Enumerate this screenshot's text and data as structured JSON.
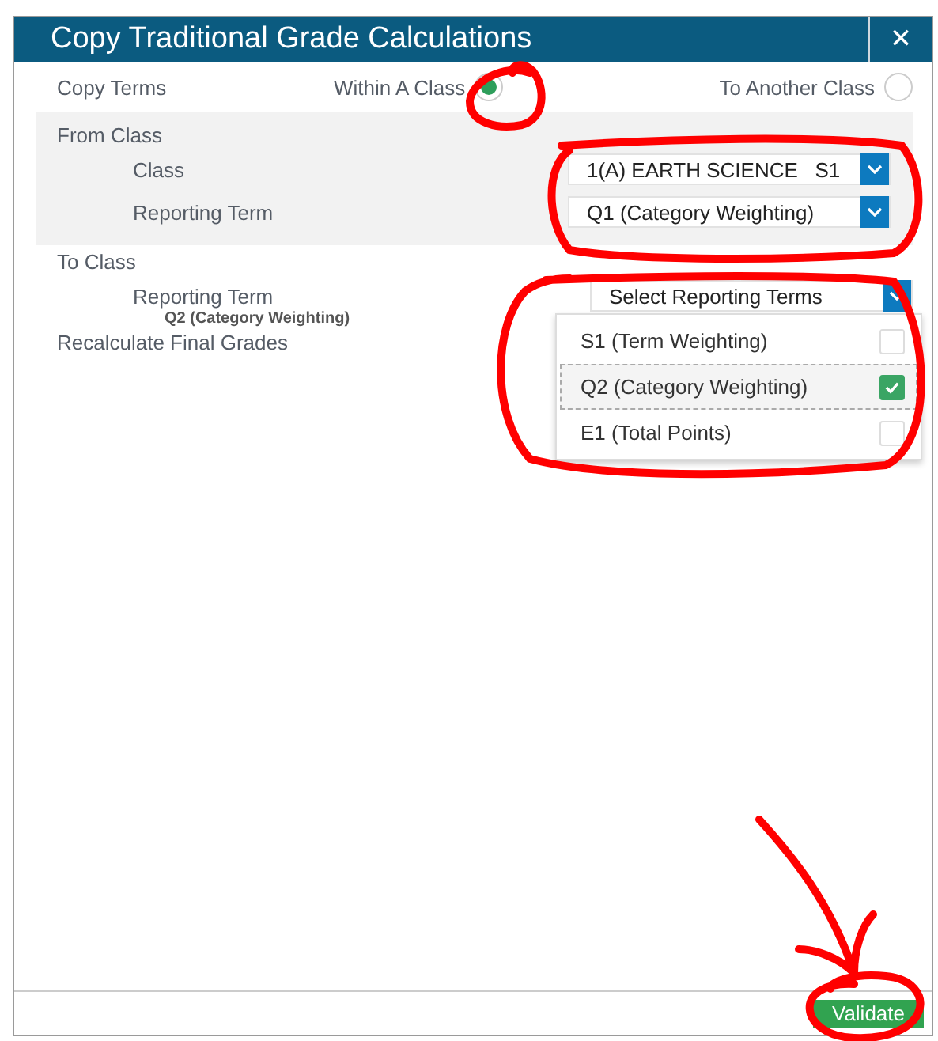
{
  "window": {
    "title": "Copy Traditional Grade Calculations",
    "close": "✕"
  },
  "copy_terms": {
    "label": "Copy Terms",
    "options": [
      {
        "label": "Within A Class",
        "selected": true
      },
      {
        "label": "To Another Class",
        "selected": false
      }
    ]
  },
  "from_class": {
    "heading": "From Class",
    "fields": [
      {
        "label": "Class",
        "value": "1(A) EARTH SCIENCE   S1"
      },
      {
        "label": "Reporting Term",
        "value": "Q1 (Category Weighting)"
      }
    ]
  },
  "to_class": {
    "heading": "To Class",
    "reporting_term": {
      "label": "Reporting Term",
      "summary": "Q2 (Category Weighting)",
      "placeholder": "Select Reporting Terms",
      "options": [
        {
          "label": "S1 (Term Weighting)",
          "checked": false,
          "selected": false
        },
        {
          "label": "Q2 (Category Weighting)",
          "checked": true,
          "selected": true
        },
        {
          "label": "E1 (Total Points)",
          "checked": false,
          "selected": false
        }
      ]
    }
  },
  "recalculate": {
    "label": "Recalculate Final Grades"
  },
  "buttons": [
    {
      "label": "Validate"
    }
  ]
}
